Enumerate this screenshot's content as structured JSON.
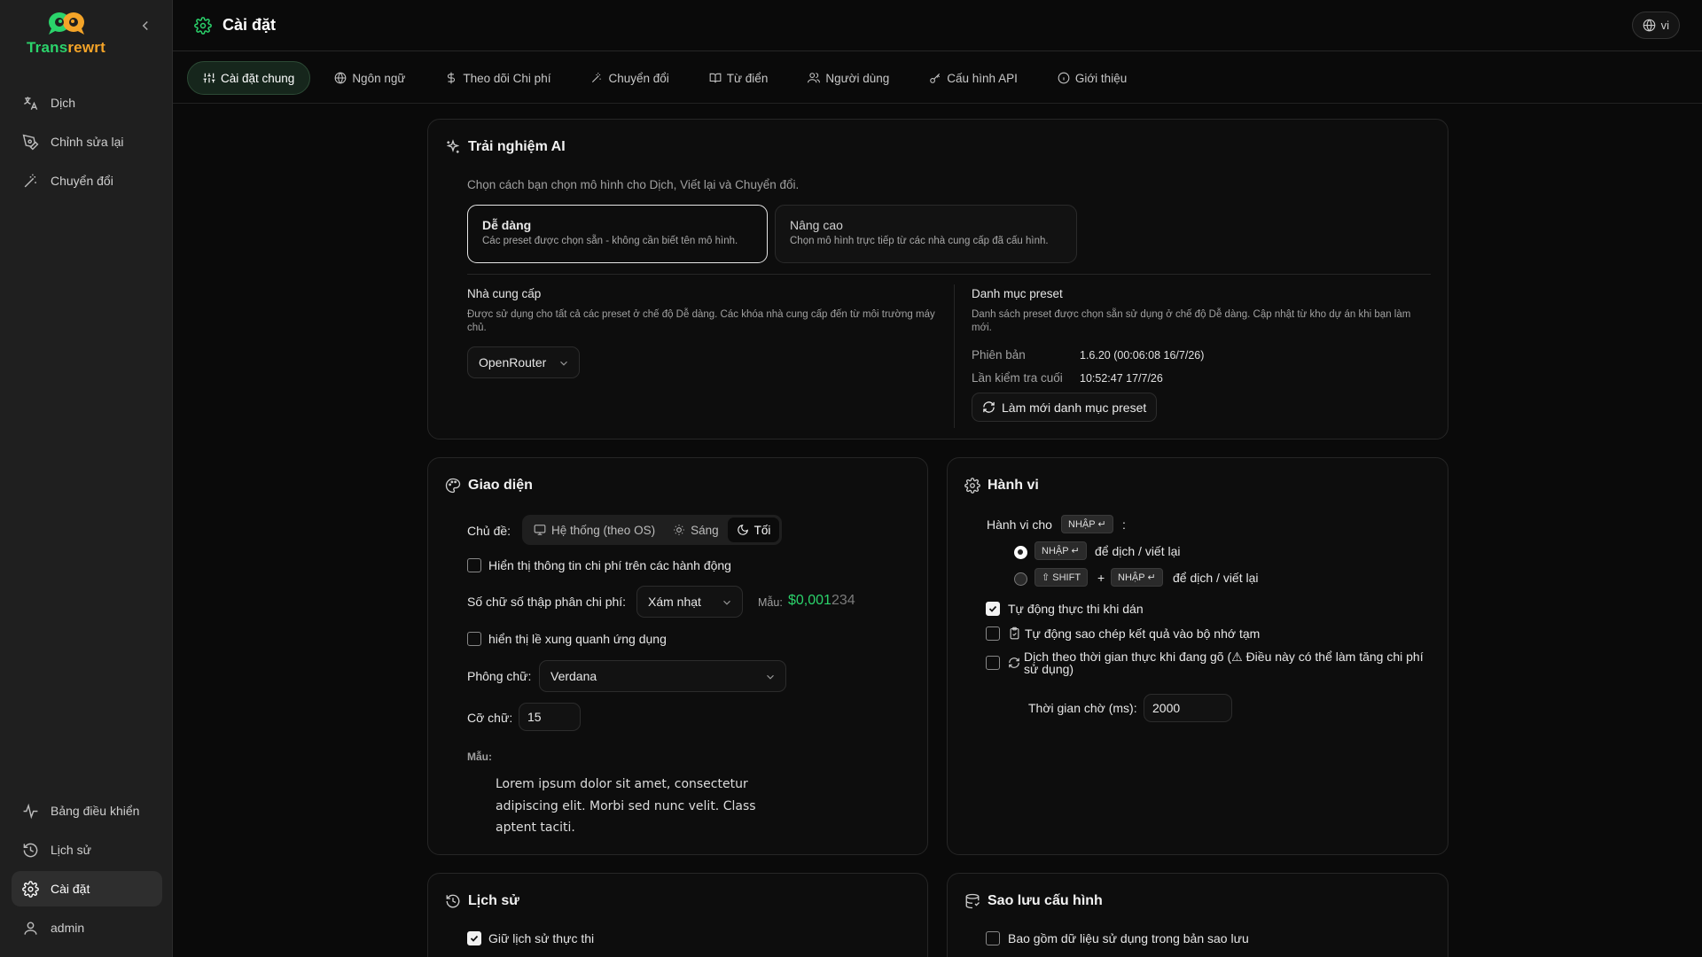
{
  "app": {
    "name_part1": "Trans",
    "name_part2": "rewrt"
  },
  "sidebar": {
    "top_items": [
      {
        "label": "Dịch"
      },
      {
        "label": "Chỉnh sửa lại"
      },
      {
        "label": "Chuyển đổi"
      }
    ],
    "bottom_items": [
      {
        "label": "Bảng điều khiển"
      },
      {
        "label": "Lịch sử"
      },
      {
        "label": "Cài đặt"
      },
      {
        "label": "admin"
      }
    ]
  },
  "header": {
    "title": "Cài đặt",
    "language": "vi"
  },
  "tabs": [
    {
      "label": "Cài đặt chung",
      "icon": "sliders-icon"
    },
    {
      "label": "Ngôn ngữ",
      "icon": "globe-icon"
    },
    {
      "label": "Theo dõi Chi phí",
      "icon": "dollar-icon"
    },
    {
      "label": "Chuyển đổi",
      "icon": "wand-icon"
    },
    {
      "label": "Từ điển",
      "icon": "book-icon"
    },
    {
      "label": "Người dùng",
      "icon": "users-icon"
    },
    {
      "label": "Cấu hình API",
      "icon": "key-icon"
    },
    {
      "label": "Giới thiệu",
      "icon": "info-icon"
    }
  ],
  "ai": {
    "title": "Trải nghiệm AI",
    "description": "Chọn cách bạn chọn mô hình cho Dịch, Viết lại và Chuyển đổi.",
    "modes": [
      {
        "title": "Dễ dàng",
        "desc": "Các preset được chọn sẵn - không cần biết tên mô hình.",
        "selected": true
      },
      {
        "title": "Nâng cao",
        "desc": "Chọn mô hình trực tiếp từ các nhà cung cấp đã cấu hình.",
        "selected": false
      }
    ],
    "provider": {
      "title": "Nhà cung cấp",
      "desc": "Được sử dụng cho tất cả các preset ở chế độ Dễ dàng. Các khóa nhà cung cấp đến từ môi trường máy chủ.",
      "value": "OpenRouter"
    },
    "catalog": {
      "title": "Danh mục preset",
      "desc": "Danh sách preset được chọn sẵn sử dụng ở chế độ Dễ dàng. Cập nhật từ kho dự án khi bạn làm mới.",
      "version_label": "Phiên bản",
      "version_value": "1.6.20 (00:06:08 16/7/26)",
      "lastcheck_label": "Lần kiểm tra cuối",
      "lastcheck_value": "10:52:47 17/7/26",
      "refresh_label": "Làm mới danh mục preset"
    }
  },
  "appearance": {
    "title": "Giao diện",
    "theme_label": "Chủ đề:",
    "theme_options": [
      "Hệ thống (theo OS)",
      "Sáng",
      "Tối"
    ],
    "theme_selected": "Tối",
    "show_cost_label": "Hiển thị thông tin chi phí trên các hành động",
    "decimals_label": "Số chữ số thập phân chi phí:",
    "decimals_value": "Xám nhạt",
    "sample_label": "Mẫu:",
    "sample_bright": "$0,001",
    "sample_dim": "234",
    "margin_label": "hiển thị lề xung quanh ứng dụng",
    "font_label": "Phông chữ:",
    "font_value": "Verdana",
    "size_label": "Cỡ chữ:",
    "size_value": "15",
    "preview_label": "Mẫu:",
    "preview_text": "Lorem ipsum dolor sit amet, consectetur adipiscing elit. Morbi sed nunc velit. Class aptent taciti."
  },
  "behavior": {
    "title": "Hành vi",
    "for_label": "Hành vi cho",
    "enter_key": "NHẬP ↵",
    "colon": ":",
    "shift_key": "⇧ SHIFT",
    "plus": "+",
    "option_text": "để dịch / viết lại",
    "auto_run_label": "Tự động thực thi khi dán",
    "auto_copy_label": "Tự động sao chép kết quả vào bộ nhớ tạm",
    "realtime_label": "Dịch theo thời gian thực khi đang gõ (⚠ Điều này có thể làm tăng chi phí sử dụng)",
    "wait_label": "Thời gian chờ (ms):",
    "wait_value": "2000"
  },
  "history": {
    "title": "Lịch sử",
    "keep_label": "Giữ lịch sử thực thi"
  },
  "backup": {
    "title": "Sao lưu cấu hình",
    "include_label": "Bao gồm dữ liệu sử dụng trong bản sao lưu"
  },
  "colors": {
    "accent_green": "#2bd36b",
    "accent_orange": "#f4a428"
  }
}
